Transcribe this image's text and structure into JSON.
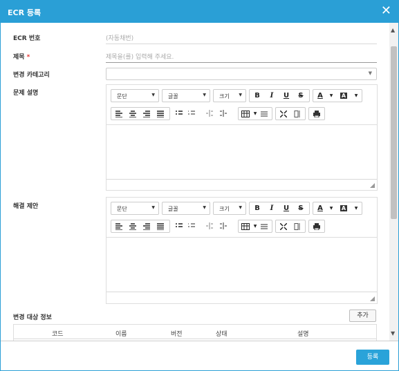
{
  "header": {
    "title": "ECR 등록",
    "close_icon": "close-icon"
  },
  "form": {
    "ecr_number": {
      "label": "ECR 번호",
      "value": "(자동채번)"
    },
    "title": {
      "label": "제목",
      "required": "*",
      "placeholder": "제목을(를) 입력해 주세요."
    },
    "category": {
      "label": "변경 카테고리",
      "value": ""
    },
    "problem": {
      "label": "문제 설명"
    },
    "solution": {
      "label": "해결 제안"
    },
    "targets": {
      "label": "변경 대상 정보",
      "add_label": "추가",
      "columns": [
        "코드",
        "이름",
        "버전",
        "상태",
        "설명"
      ]
    }
  },
  "editor_toolbar": {
    "paragraph": "문단",
    "font": "글꼴",
    "size": "크기",
    "bold": "B",
    "italic": "I",
    "underline": "U",
    "strike": "S",
    "font_color": "A",
    "bg_color": "A"
  },
  "footer": {
    "submit_label": "등록"
  },
  "colors": {
    "accent": "#2a9fd6",
    "button": "#2aa3d9",
    "required": "#e53935"
  }
}
